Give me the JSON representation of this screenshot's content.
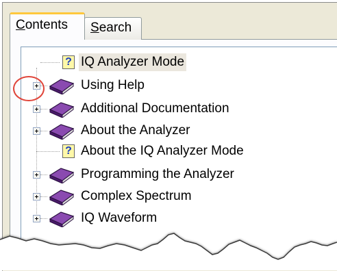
{
  "tabs": {
    "contents_prefix": "C",
    "contents_rest": "ontents",
    "search_prefix": "S",
    "search_rest": "earch"
  },
  "tree": {
    "items": [
      {
        "label": "IQ Analyzer Mode",
        "icon": "help-page-icon",
        "expandable": false,
        "selected": true
      },
      {
        "label": "Using Help",
        "icon": "book-icon",
        "expandable": true,
        "selected": false
      },
      {
        "label": "Additional Documentation",
        "icon": "book-icon",
        "expandable": true,
        "selected": false
      },
      {
        "label": "About the Analyzer",
        "icon": "book-icon",
        "expandable": true,
        "selected": false
      },
      {
        "label": "About the IQ Analyzer Mode",
        "icon": "help-page-icon",
        "expandable": false,
        "selected": false
      },
      {
        "label": "Programming the Analyzer",
        "icon": "book-icon",
        "expandable": true,
        "selected": false
      },
      {
        "label": "Complex Spectrum",
        "icon": "book-icon",
        "expandable": true,
        "selected": false
      },
      {
        "label": "IQ Waveform",
        "icon": "book-icon",
        "expandable": true,
        "selected": false
      }
    ]
  },
  "help_icon_glyph": "?",
  "colors": {
    "book": "#6a2a8c",
    "tab_accent": "#ffc83c",
    "highlight": "#e0453a"
  }
}
